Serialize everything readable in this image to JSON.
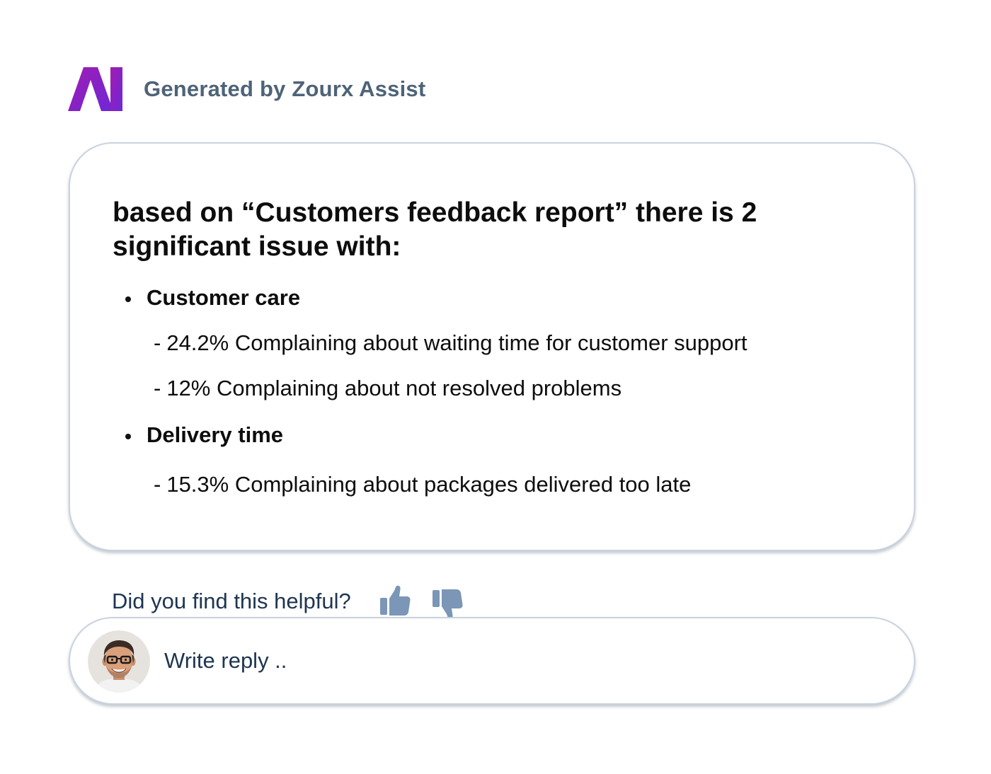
{
  "header": {
    "logo_icon": "ai-sparkle-logo-icon",
    "logo_colors": [
      "#a21caf",
      "#7c3aed"
    ],
    "title": "Generated by Zourx Assist"
  },
  "response": {
    "intro": "based on “Customers feedback report” there is 2 significant issue with:",
    "issues": [
      {
        "title": "Customer care",
        "details": [
          "24.2% Complaining about waiting time for customer support",
          "12% Complaining about not resolved problems"
        ]
      },
      {
        "title": "Delivery time",
        "details": [
          "15.3% Complaining about packages delivered too late"
        ]
      }
    ],
    "detail_prefix": "-"
  },
  "feedback": {
    "question": "Did you find this helpful?",
    "thumbs_up_icon": "thumbs-up-icon",
    "thumbs_down_icon": "thumbs-down-icon",
    "icon_color": "#7b96b6"
  },
  "reply": {
    "avatar_icon": "user-avatar",
    "placeholder": "Write reply .."
  }
}
